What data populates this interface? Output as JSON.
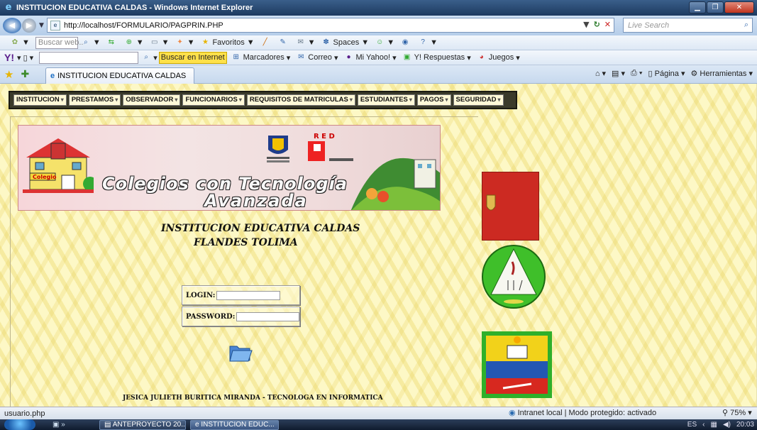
{
  "window": {
    "title": "INSTITUCION EDUCATIVA CALDAS - Windows Internet Explorer",
    "controls": [
      "minimize",
      "maximize",
      "close"
    ]
  },
  "address_bar": {
    "url": "http://localhost/FORMULARIO/PAGPRIN.PHP",
    "search_placeholder": "Live Search"
  },
  "toolbar1": {
    "search_placeholder": "Buscar web..",
    "favoritos": "Favoritos",
    "spaces": "Spaces"
  },
  "toolbar2": {
    "buscar_btn": "Buscar en Internet",
    "marcadores": "Marcadores",
    "correo": "Correo",
    "mi_yahoo": "Mi Yahoo!",
    "respuestas": "Y! Respuestas",
    "juegos": "Juegos"
  },
  "tabs": {
    "active_tab": "INSTITUCION EDUCATIVA CALDAS",
    "pagina": "Página",
    "herramientas": "Herramientas"
  },
  "menu": {
    "items": [
      {
        "label": "INSTITUCION"
      },
      {
        "label": "PRESTAMOS"
      },
      {
        "label": "OBSERVADOR"
      },
      {
        "label": "FUNCIONARIOS"
      },
      {
        "label": "REQUISITOS DE MATRICULAS"
      },
      {
        "label": "ESTUDIANTES"
      },
      {
        "label": "PAGOS"
      },
      {
        "label": "SEGURIDAD"
      }
    ]
  },
  "banner": {
    "title_line1": "Colegios con Tecnología",
    "title_line2": "Avanzada",
    "school_sign": "Colegio"
  },
  "page": {
    "institution_line1": "INSTITUCION EDUCATIVA CALDAS",
    "institution_line2": "FLANDES TOLIMA",
    "login_label": "LOGIN:",
    "password_label": "PASSWORD:",
    "login_value": "",
    "password_value": "",
    "footer": "JESICA JULIETH BURITICA MIRANDA - TECNOLOGA EN INFORMATICA"
  },
  "status_bar": {
    "left_text": "usuario.php",
    "zone": "Intranet local | Modo protegido: activado",
    "zoom": "75%"
  },
  "taskbar": {
    "task1": "ANTEPROYECTO 20...",
    "task2": "INSTITUCION EDUC...",
    "lang": "ES",
    "time": "20:03"
  },
  "colors": {
    "page_background": "#fdf8c6",
    "menu_bar": "#3a3a2a",
    "side_logo_red": "#cc2a22"
  }
}
